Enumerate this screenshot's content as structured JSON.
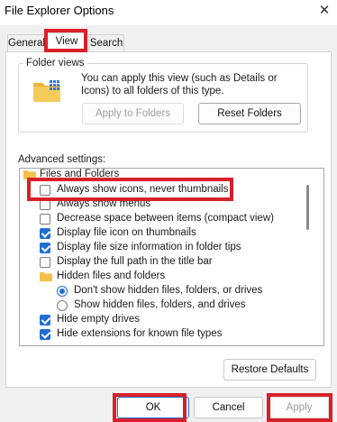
{
  "window": {
    "title": "File Explorer Options",
    "close_glyph": "✕"
  },
  "tabs": [
    {
      "label": "General"
    },
    {
      "label": "View"
    },
    {
      "label": "Search"
    }
  ],
  "folder_views": {
    "legend": "Folder views",
    "description": "You can apply this view (such as Details or Icons) to all folders of this type.",
    "apply_label": "Apply to Folders",
    "reset_label": "Reset Folders"
  },
  "advanced": {
    "label": "Advanced settings:",
    "items": [
      {
        "label": "Files and Folders",
        "kind": "folder"
      },
      {
        "label": "Always show icons, never thumbnails",
        "kind": "checkbox",
        "checked": false
      },
      {
        "label": "Always show menus",
        "kind": "checkbox",
        "checked": false
      },
      {
        "label": "Decrease space between items (compact view)",
        "kind": "checkbox",
        "checked": false
      },
      {
        "label": "Display file icon on thumbnails",
        "kind": "checkbox",
        "checked": true
      },
      {
        "label": "Display file size information in folder tips",
        "kind": "checkbox",
        "checked": true
      },
      {
        "label": "Display the full path in the title bar",
        "kind": "checkbox",
        "checked": false
      },
      {
        "label": "Hidden files and folders",
        "kind": "folder"
      },
      {
        "label": "Don't show hidden files, folders, or drives",
        "kind": "radio",
        "checked": true
      },
      {
        "label": "Show hidden files, folders, and drives",
        "kind": "radio",
        "checked": false
      },
      {
        "label": "Hide empty drives",
        "kind": "checkbox",
        "checked": true
      },
      {
        "label": "Hide extensions for known file types",
        "kind": "checkbox",
        "checked": true
      }
    ]
  },
  "restore_defaults_label": "Restore Defaults",
  "footer": {
    "ok_label": "OK",
    "cancel_label": "Cancel",
    "apply_label": "Apply"
  },
  "colors": {
    "highlight": "#d8202a",
    "checkbox_checked": "#1f6ed4",
    "folder_yellow": "#f3c24a"
  }
}
